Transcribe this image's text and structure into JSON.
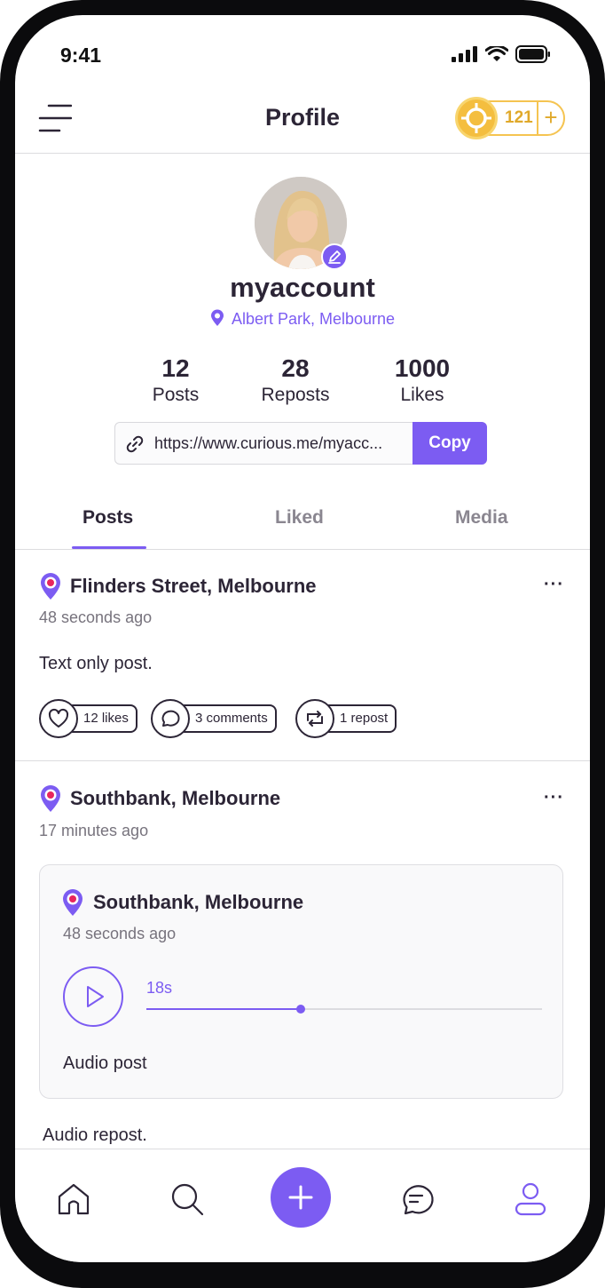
{
  "status_bar": {
    "time": "9:41"
  },
  "header": {
    "title": "Profile",
    "coins": "121",
    "coin_add": "+"
  },
  "profile": {
    "username": "myaccount",
    "location": "Albert Park, Melbourne",
    "stats": [
      {
        "value": "12",
        "label": "Posts"
      },
      {
        "value": "28",
        "label": "Reposts"
      },
      {
        "value": "1000",
        "label": "Likes"
      }
    ],
    "link": "https://www.curious.me/myacc...",
    "copy_label": "Copy"
  },
  "tabs": [
    {
      "label": "Posts",
      "active": true
    },
    {
      "label": "Liked",
      "active": false
    },
    {
      "label": "Media",
      "active": false
    }
  ],
  "posts": [
    {
      "location": "Flinders Street, Melbourne",
      "time": "48 seconds ago",
      "text": "Text only post.",
      "actions": {
        "likes": "12 likes",
        "comments": "3 comments",
        "reposts": "1 repost"
      }
    },
    {
      "location": "Southbank, Melbourne",
      "time": "17 minutes ago",
      "repost": {
        "location": "Southbank, Melbourne",
        "time": "48 seconds ago",
        "audio_duration": "18s",
        "audio_progress": 0.39,
        "caption": "Audio post"
      },
      "text": "Audio repost."
    }
  ],
  "colors": {
    "accent": "#7c5cf2",
    "coin": "#f4be3f",
    "text": "#2c2536"
  },
  "bottom_nav": [
    "home-icon",
    "search-icon",
    "add-icon",
    "messages-icon",
    "profile-icon"
  ]
}
